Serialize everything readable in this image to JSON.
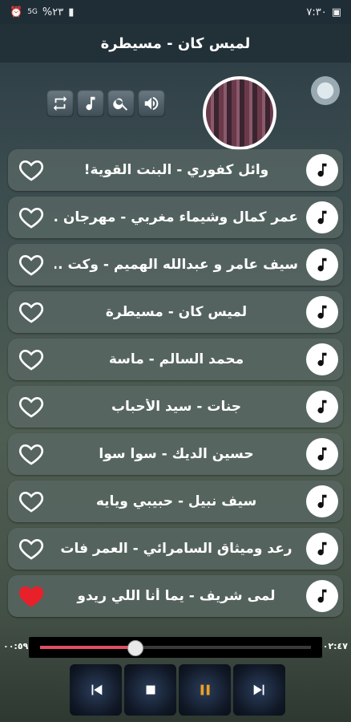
{
  "status_bar": {
    "time": "٧:٣٠",
    "battery": "%٢٣",
    "network": "5G"
  },
  "header": {
    "title": "لميس كان - مسيطرة"
  },
  "controls": [
    {
      "name": "repeat-icon"
    },
    {
      "name": "music-note-icon"
    },
    {
      "name": "search-icon"
    },
    {
      "name": "volume-icon"
    }
  ],
  "songs": [
    {
      "title": "وائل كفوري - البنت القوية!",
      "favorite": false
    },
    {
      "title": "عمر كمال وشيماء مغربي - مهرجان ...",
      "favorite": false
    },
    {
      "title": "سيف عامر و عبدالله الهميم - وكت ...",
      "favorite": false
    },
    {
      "title": "لميس كان - مسيطرة",
      "favorite": false
    },
    {
      "title": "محمد السالم - ماسة",
      "favorite": false
    },
    {
      "title": "جنات - سيد الأحباب",
      "favorite": false
    },
    {
      "title": "حسين الديك - سوا سوا",
      "favorite": false
    },
    {
      "title": "سيف نبيل - حبيبي ويايه",
      "favorite": false
    },
    {
      "title": "رعد وميثاق السامرائي - العمر فات",
      "favorite": false
    },
    {
      "title": "لمى شريف - يما أنا اللي ريدو",
      "favorite": true
    }
  ],
  "player": {
    "elapsed": "٠٠:٥٩",
    "duration": "٠٢:٤٧",
    "progress_fraction": 0.35
  },
  "colors": {
    "heart_outline": "#ffffff",
    "heart_filled": "#e8202a",
    "progress_fill": "#e05060",
    "pause_color": "#f0a020"
  }
}
